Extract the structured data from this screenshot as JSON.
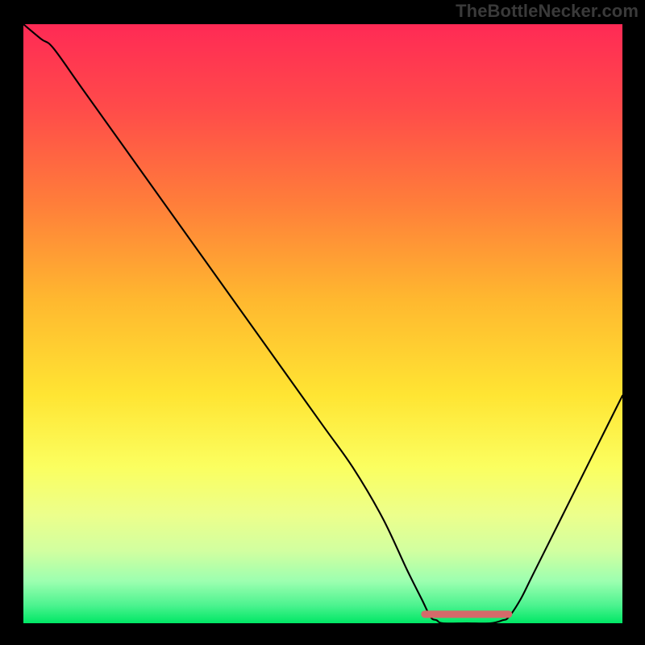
{
  "attribution": "TheBottleNecker.com",
  "chart_data": {
    "type": "line",
    "title": "",
    "xlabel": "",
    "ylabel": "",
    "xlim": [
      0,
      100
    ],
    "ylim": [
      0,
      100
    ],
    "series": [
      {
        "name": "curve",
        "values_xy": [
          [
            0,
            100
          ],
          [
            3,
            97.5
          ],
          [
            5,
            96
          ],
          [
            10,
            89
          ],
          [
            20,
            75
          ],
          [
            30,
            61
          ],
          [
            40,
            47
          ],
          [
            50,
            33
          ],
          [
            55,
            26
          ],
          [
            60,
            17.5
          ],
          [
            64,
            9
          ],
          [
            66.5,
            4
          ],
          [
            68,
            1
          ],
          [
            69,
            0.5
          ],
          [
            70,
            0
          ],
          [
            74,
            0
          ],
          [
            78,
            0
          ],
          [
            80,
            0.5
          ],
          [
            81,
            1
          ],
          [
            83,
            4
          ],
          [
            85,
            8
          ],
          [
            90,
            18
          ],
          [
            94,
            26
          ],
          [
            97,
            32
          ],
          [
            100,
            38
          ]
        ]
      },
      {
        "name": "highlight-band",
        "values_xy": [
          [
            67,
            1.5
          ],
          [
            81,
            1.5
          ]
        ]
      }
    ],
    "colors": {
      "gradient_top": "#ff2a55",
      "gradient_mid": "#ffe533",
      "gradient_bottom": "#00e765",
      "curve": "#000000",
      "highlight": "#d46a6a"
    }
  }
}
